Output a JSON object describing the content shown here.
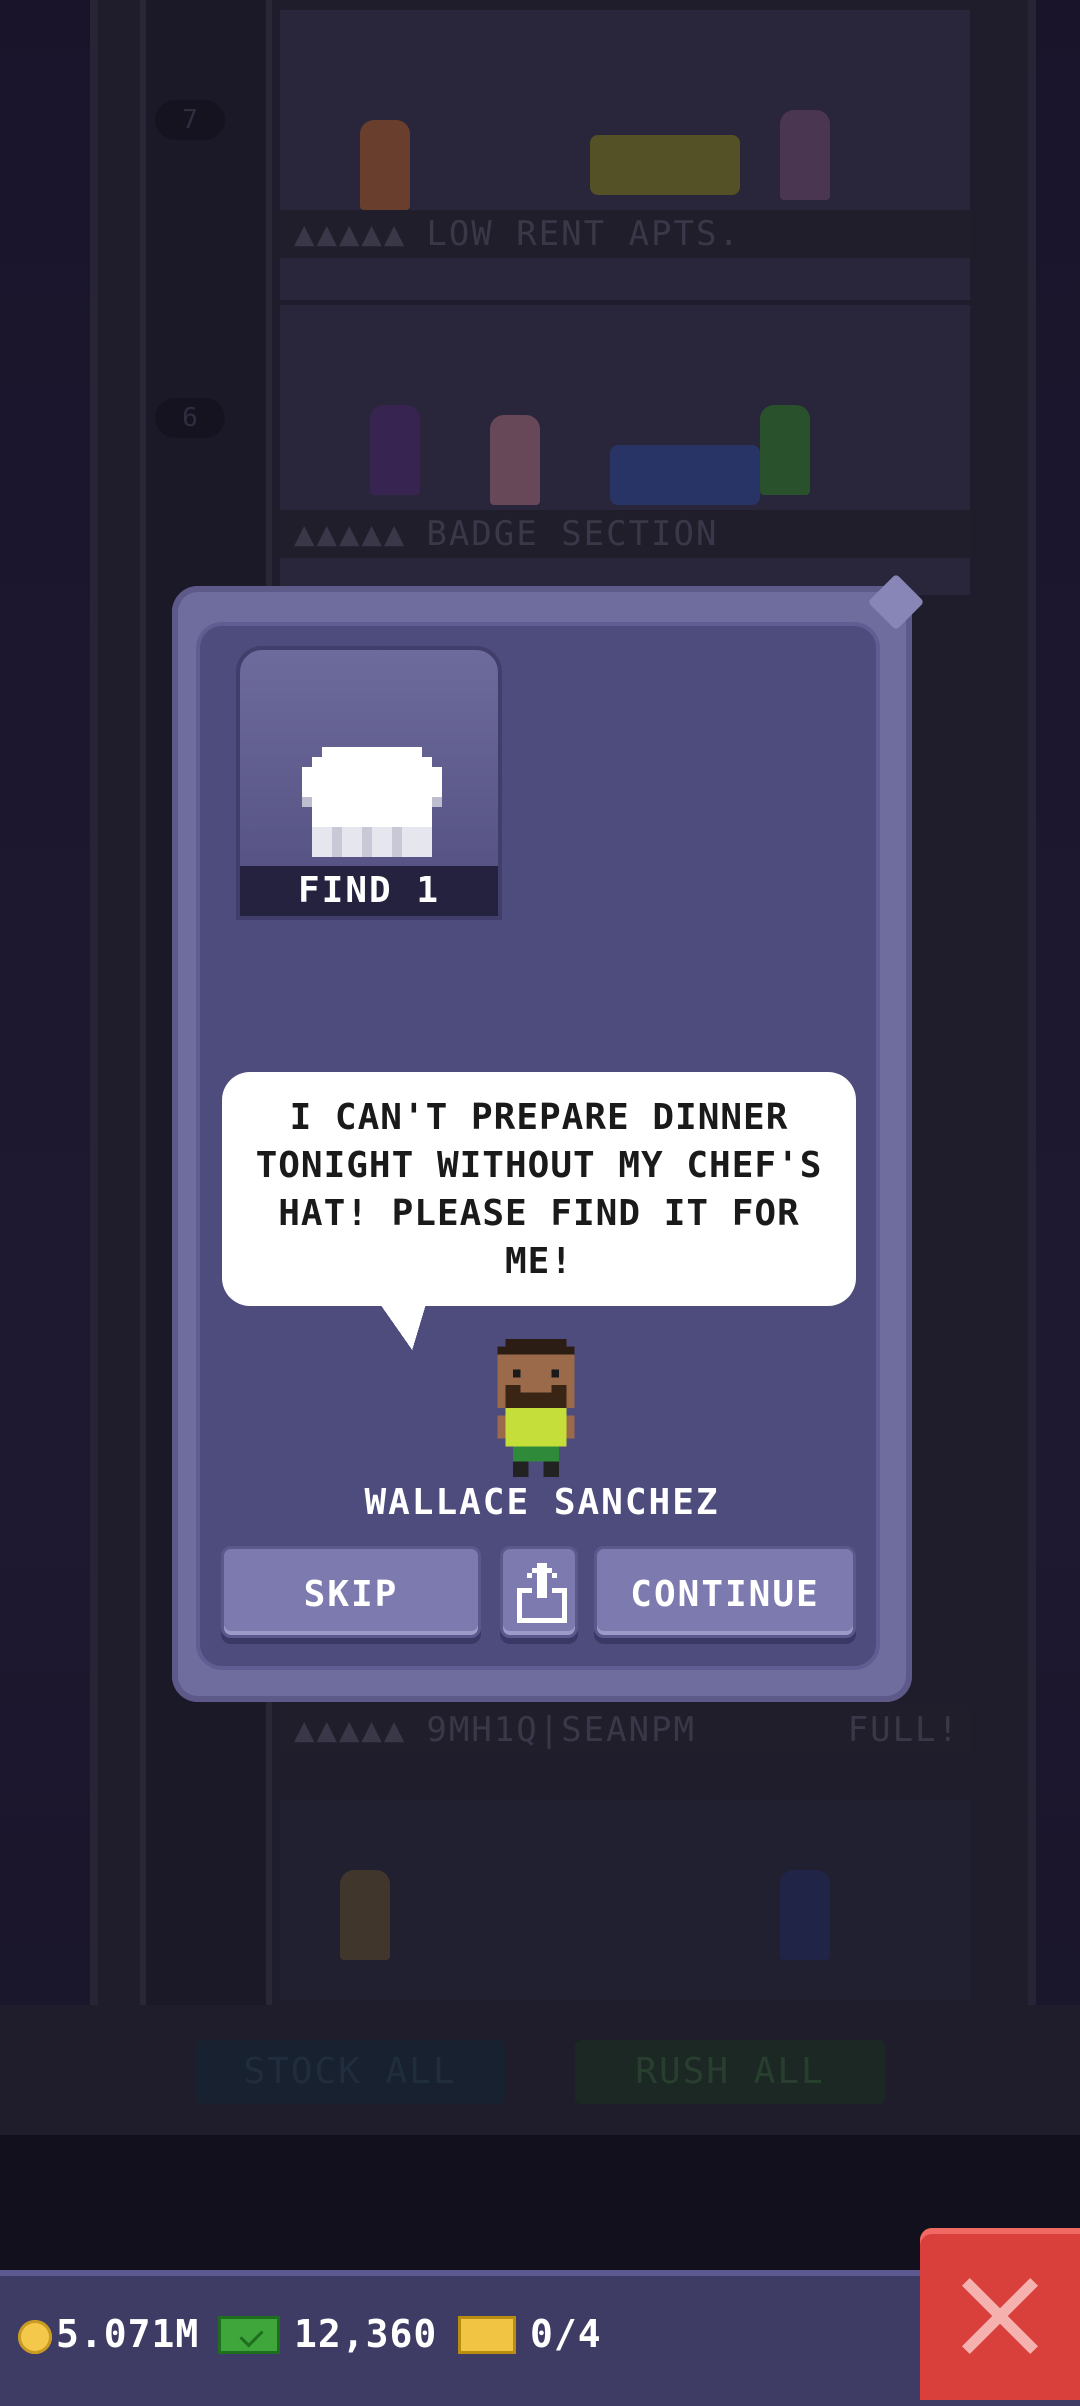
{
  "background": {
    "floors": [
      {
        "number": "7",
        "label": "LOW RENT APTS.",
        "stars": "▲▲▲▲▲"
      },
      {
        "number": "6",
        "label": "BADGE SECTION",
        "stars": "▲▲▲▲▲"
      },
      {
        "label": "9MH1Q|SEANPM",
        "stars": "▲▲▲▲▲",
        "status": "FULL!"
      }
    ],
    "buttons": {
      "stock_all": "STOCK ALL",
      "rush_all": "RUSH ALL"
    }
  },
  "mission": {
    "item_icon": "chef-hat-icon",
    "find_label": "FIND 1",
    "message": "I CAN'T PREPARE DINNER TONIGHT WITHOUT MY CHEF'S HAT! PLEASE FIND IT FOR ME!",
    "npc_name": "WALLACE SANCHEZ",
    "buttons": {
      "skip": "SKIP",
      "continue": "CONTINUE",
      "share_icon": "share-icon"
    }
  },
  "hud": {
    "coins": "5.071M",
    "bux": "12,360",
    "tickets": "0/4",
    "close_icon": "close-icon"
  },
  "colors": {
    "modal_frame": "#6f6c9e",
    "modal_inner": "#4e4b7d",
    "button": "#7c7aaf",
    "close_button": "#d9403c",
    "hud": "#3e3c64"
  }
}
